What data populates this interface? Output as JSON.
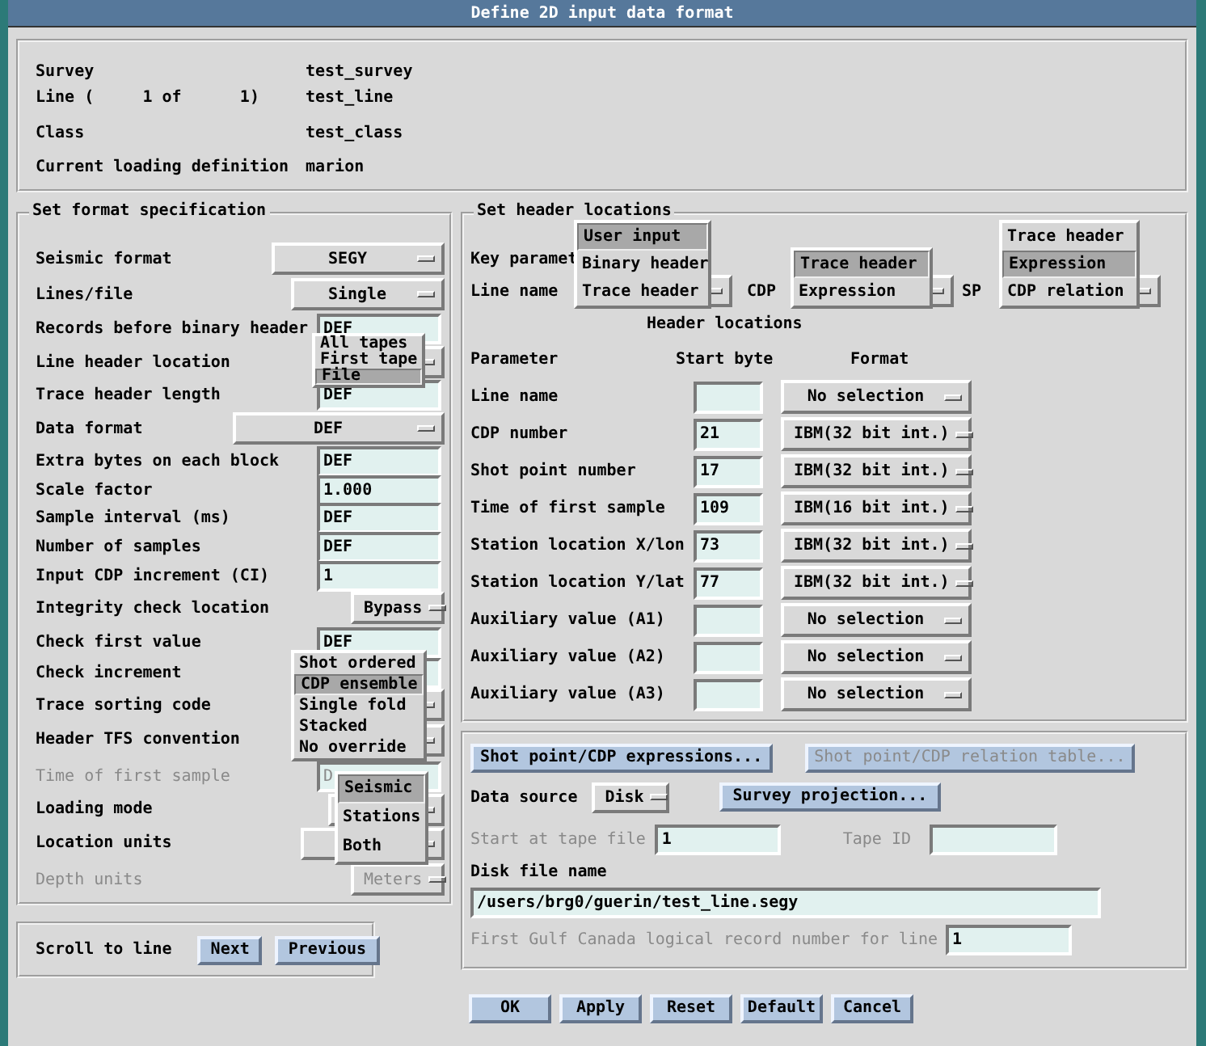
{
  "window": {
    "title": "Define 2D input data format"
  },
  "info": {
    "rows": [
      {
        "label": "Survey",
        "value": "test_survey"
      },
      {
        "label": "Line (     1 of      1)",
        "value": "test_line"
      },
      {
        "label": "Class",
        "value": "test_class"
      },
      {
        "label": "Current loading definition",
        "value": "marion"
      }
    ]
  },
  "format_spec": {
    "title": "Set format specification",
    "rows": [
      {
        "label": "Seismic format",
        "kind": "menu",
        "value": "SEGY",
        "disabled": false
      },
      {
        "label": "Lines/file",
        "kind": "menu",
        "value": "Single",
        "disabled": false
      },
      {
        "label": "Records before binary header",
        "kind": "field",
        "value": "DEF",
        "disabled": false
      },
      {
        "label": "Line header location",
        "kind": "menu",
        "disabled": false,
        "popup": [
          {
            "label": "All tapes",
            "selected": false
          },
          {
            "label": "First tape",
            "selected": false
          },
          {
            "label": "File",
            "selected": true
          }
        ]
      },
      {
        "label": "Trace header length",
        "kind": "field",
        "value": "DEF",
        "disabled": false
      },
      {
        "label": "Data format",
        "kind": "menu",
        "value": "DEF",
        "disabled": false
      },
      {
        "label": "Extra bytes on each block",
        "kind": "field",
        "value": "DEF",
        "disabled": false
      },
      {
        "label": "Scale factor",
        "kind": "field",
        "value": "1.000",
        "disabled": false
      },
      {
        "label": "Sample interval (ms)",
        "kind": "field",
        "value": "DEF",
        "disabled": false
      },
      {
        "label": "Number of samples",
        "kind": "field",
        "value": "DEF",
        "disabled": false
      },
      {
        "label": "Input CDP increment (CI)",
        "kind": "field",
        "value": "1",
        "disabled": false
      },
      {
        "label": "Integrity check location",
        "kind": "menu",
        "value": "Bypass",
        "disabled": false
      },
      {
        "label": "Check first value",
        "kind": "field",
        "value": "DEF",
        "disabled": false
      },
      {
        "label": "Check increment",
        "kind": "field",
        "disabled": false
      },
      {
        "label": "Trace sorting code",
        "kind": "menu",
        "disabled": false,
        "popup": [
          {
            "label": "Shot ordered",
            "selected": false
          },
          {
            "label": "CDP ensemble",
            "selected": true
          },
          {
            "label": "Single fold",
            "selected": false
          },
          {
            "label": "Stacked",
            "selected": false
          },
          {
            "label": "No override",
            "selected": false
          }
        ]
      },
      {
        "label": "Header TFS convention",
        "kind": "menu",
        "disabled": false
      },
      {
        "label": "Time of first sample",
        "kind": "field",
        "value": "D",
        "disabled": true
      },
      {
        "label": "Loading mode",
        "kind": "menu",
        "disabled": false,
        "popup": [
          {
            "label": "Seismic",
            "selected": true
          },
          {
            "label": "Stations",
            "selected": false
          },
          {
            "label": "Both",
            "selected": false
          }
        ]
      },
      {
        "label": "Location units",
        "kind": "menu",
        "disabled": false
      },
      {
        "label": "Depth units",
        "kind": "menu",
        "value": "Meters",
        "disabled": true
      }
    ]
  },
  "scroll": {
    "label": "Scroll to line",
    "buttons": [
      "Next",
      "Previous"
    ]
  },
  "header": {
    "title": "Set header locations",
    "key_label": "Key paramet",
    "keys": [
      {
        "label": "Line name",
        "popup": [
          {
            "label": "User input",
            "selected": true
          },
          {
            "label": "Binary header",
            "selected": false
          },
          {
            "label": "Trace header",
            "selected": false
          }
        ]
      },
      {
        "label": "CDP",
        "popup": [
          {
            "label": "Trace header",
            "selected": true
          },
          {
            "label": "Expression",
            "selected": false
          }
        ]
      },
      {
        "label": "SP",
        "popup": [
          {
            "label": "Trace header",
            "selected": false
          },
          {
            "label": "Expression",
            "selected": true
          },
          {
            "label": "CDP relation",
            "selected": false
          }
        ]
      }
    ],
    "table_title": "Header locations",
    "columns": [
      "Parameter",
      "Start byte",
      "Format"
    ],
    "rows": [
      {
        "parameter": "Line name",
        "format": "No selection"
      },
      {
        "parameter": "CDP number",
        "start_byte": "21",
        "format": "IBM(32 bit int.)"
      },
      {
        "parameter": "Shot point number",
        "start_byte": "17",
        "format": "IBM(32 bit int.)"
      },
      {
        "parameter": "Time of first sample",
        "start_byte": "109",
        "format": "IBM(16 bit int.)"
      },
      {
        "parameter": "Station location X/lon",
        "start_byte": "73",
        "format": "IBM(32 bit int.)"
      },
      {
        "parameter": "Station location Y/lat",
        "start_byte": "77",
        "format": "IBM(32 bit int.)"
      },
      {
        "parameter": "Auxiliary value (A1)",
        "format": "No selection"
      },
      {
        "parameter": "Auxiliary value (A2)",
        "format": "No selection"
      },
      {
        "parameter": "Auxiliary value (A3)",
        "format": "No selection"
      }
    ]
  },
  "source": {
    "buttons": [
      {
        "label": "Shot point/CDP expressions...",
        "disabled": false
      },
      {
        "label": "Shot point/CDP relation table...",
        "disabled": true
      }
    ],
    "data_source": {
      "label": "Data source",
      "value": "Disk"
    },
    "projection_button": "Survey projection...",
    "start_tape": {
      "label": "Start at tape file",
      "value": "1",
      "disabled": true
    },
    "tape_id": {
      "label": "Tape ID",
      "disabled": true
    },
    "disk_file": {
      "label": "Disk file name",
      "value": "/users/brg0/guerin/test_line.segy"
    },
    "logical_record": {
      "label": "First Gulf Canada logical record number for line",
      "value": "1",
      "disabled": true
    }
  },
  "buttons": [
    "OK",
    "Apply",
    "Reset",
    "Default",
    "Cancel"
  ]
}
